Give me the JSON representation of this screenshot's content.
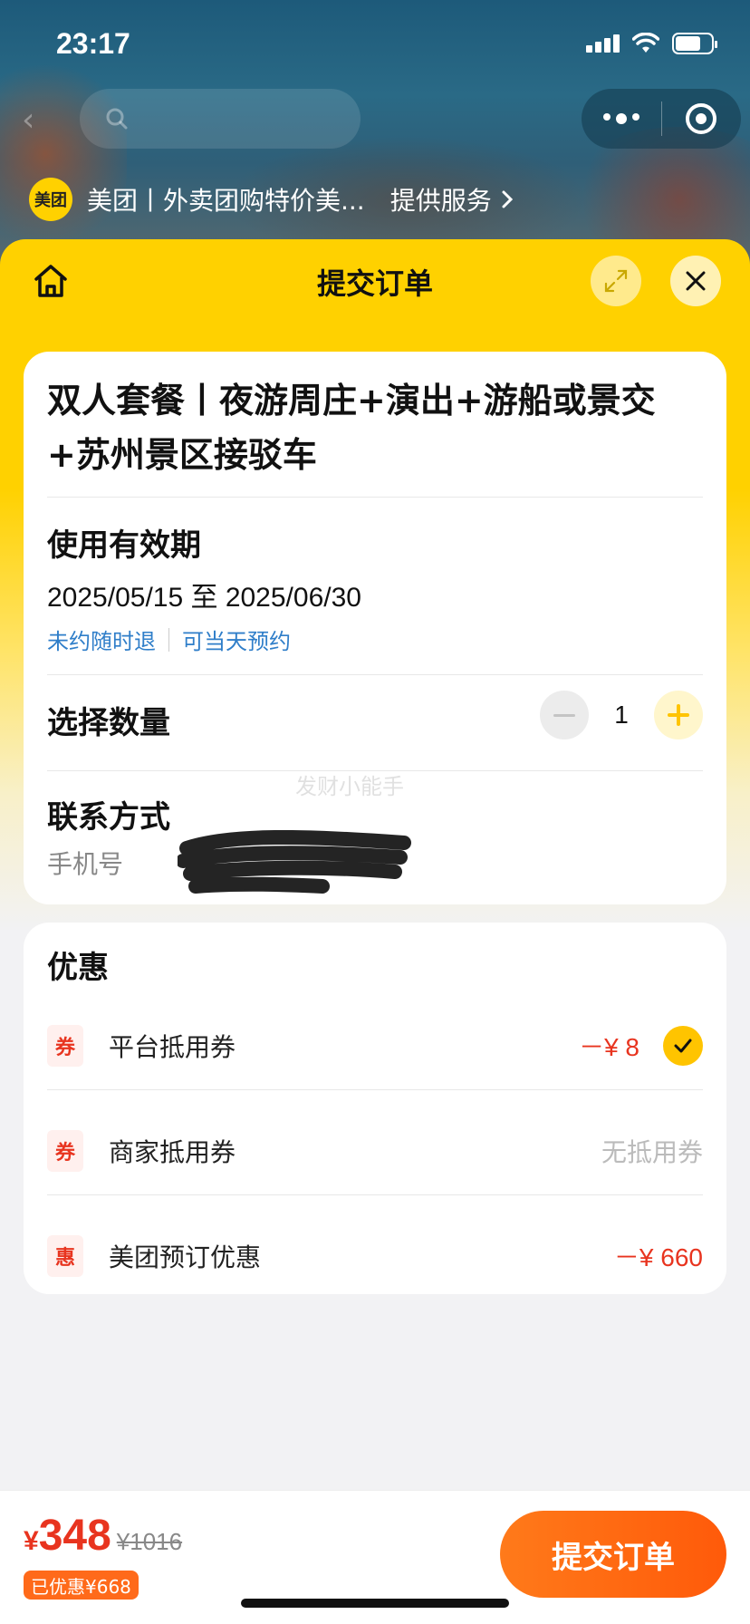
{
  "status_bar": {
    "time": "23:17"
  },
  "mini_program": {
    "logo_text": "美团",
    "provider_name": "美团丨外卖团购特价美...",
    "service_link": "提供服务"
  },
  "sheet": {
    "title": "提交订单",
    "product": {
      "title": "双人套餐丨夜游周庄+演出+游船或景交+苏州景区接驳车"
    },
    "validity": {
      "label": "使用有效期",
      "dates": "2025/05/15 至 2025/06/30",
      "tags": [
        "未约随时退",
        "可当天预约"
      ]
    },
    "quantity": {
      "label": "选择数量",
      "value": "1"
    },
    "contact": {
      "label": "联系方式",
      "phone_label": "手机号",
      "watermark": "发财小能手"
    },
    "discounts": {
      "title": "优惠",
      "items": [
        {
          "badge": "券",
          "label": "平台抵用券",
          "value": "－¥ 8",
          "selected": true
        },
        {
          "badge": "券",
          "label": "商家抵用券",
          "value": "无抵用券",
          "selected": false
        },
        {
          "badge": "惠",
          "label": "美团预订优惠",
          "value": "－¥ 660",
          "selected": false
        }
      ]
    }
  },
  "footer": {
    "currency": "¥",
    "price": "348",
    "original_price": "¥1016",
    "saved": "已优惠¥668",
    "submit_label": "提交订单"
  },
  "colors": {
    "brand_yellow": "#ffd100",
    "accent_red": "#e8341f",
    "submit_orange": "#ff6a1a",
    "link_blue": "#2f7ec9"
  }
}
